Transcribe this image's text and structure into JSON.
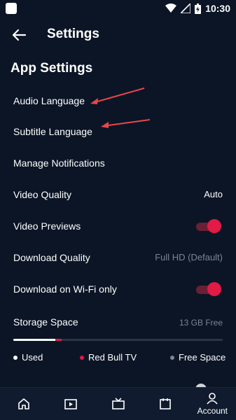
{
  "status_bar": {
    "time": "10:30"
  },
  "header": {
    "title": "Settings"
  },
  "section": {
    "heading": "App Settings"
  },
  "settings": {
    "audio_language": "Audio Language",
    "subtitle_language": "Subtitle Language",
    "manage_notifications": "Manage Notifications",
    "video_quality": {
      "label": "Video Quality",
      "value": "Auto"
    },
    "video_previews": {
      "label": "Video Previews",
      "enabled": true
    },
    "download_quality": {
      "label": "Download Quality",
      "value": "Full HD (Default)"
    },
    "download_wifi_only": {
      "label": "Download on Wi-Fi only",
      "enabled": true
    }
  },
  "storage": {
    "label": "Storage Space",
    "value": "13 GB Free",
    "used_fraction": 0.2,
    "redbull_fraction": 0.03,
    "legend": {
      "used": "Used",
      "redbull": "Red Bull TV",
      "free": "Free Space"
    },
    "colors": {
      "used": "#ffffff",
      "redbull": "#e11a46",
      "free": "#7c8594"
    }
  },
  "bottom_nav": {
    "items": [
      {
        "icon": "home-icon",
        "label": ""
      },
      {
        "icon": "video-library-icon",
        "label": ""
      },
      {
        "icon": "tv-icon",
        "label": ""
      },
      {
        "icon": "calendar-icon",
        "label": ""
      },
      {
        "icon": "account-icon",
        "label": "Account",
        "active": true
      }
    ]
  },
  "colors": {
    "background": "#0b1526",
    "accent": "#e11a46"
  }
}
